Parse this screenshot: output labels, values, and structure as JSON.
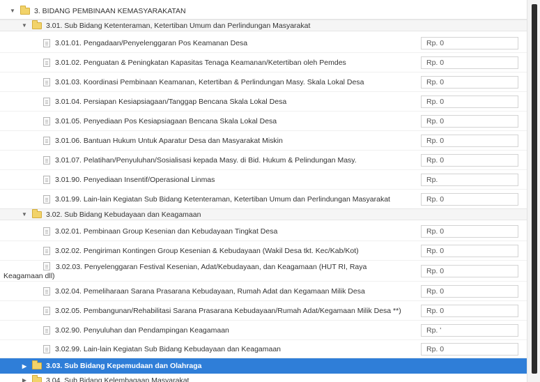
{
  "tree": {
    "bidang": "3. BIDANG PEMBINAAN KEMASYARAKATAN",
    "sub1": "3.01. Sub Bidang Ketenteraman, Ketertiban Umum dan Perlindungan Masyarakat",
    "items1": [
      {
        "label": "3.01.01. Pengadaan/Penyelenggaran Pos Keamanan Desa",
        "value": "Rp. 0"
      },
      {
        "label": "3.01.02. Penguatan & Peningkatan Kapasitas Tenaga Keamanan/Ketertiban oleh Pemdes",
        "value": "Rp. 0"
      },
      {
        "label": "3.01.03. Koordinasi Pembinaan Keamanan, Ketertiban & Perlindungan Masy. Skala Lokal Desa",
        "value": "Rp. 0"
      },
      {
        "label": "3.01.04. Persiapan Kesiapsiagaan/Tanggap Bencana Skala Lokal Desa",
        "value": "Rp. 0"
      },
      {
        "label": "3.01.05. Penyediaan Pos Kesiapsiagaan Bencana Skala Lokal Desa",
        "value": "Rp. 0"
      },
      {
        "label": "3.01.06. Bantuan Hukum Untuk Aparatur Desa dan Masyarakat Miskin",
        "value": "Rp. 0"
      },
      {
        "label": "3.01.07. Pelatihan/Penyuluhan/Sosialisasi kepada Masy. di Bid. Hukum & Pelindungan Masy.",
        "value": "Rp. 0"
      },
      {
        "label": "3.01.90. Penyediaan Insentif/Operasional Linmas",
        "value": "Rp."
      },
      {
        "label": "3.01.99. Lain-lain Kegiatan Sub Bidang Ketenteraman, Ketertiban Umum dan Perlindungan Masyarakat",
        "value": "Rp. 0"
      }
    ],
    "sub2": "3.02. Sub Bidang Kebudayaan dan Keagamaan",
    "items2": [
      {
        "label": "3.02.01. Pembinaan Group Kesenian dan Kebudayaan Tingkat Desa",
        "value": "Rp. 0"
      },
      {
        "label": "3.02.02. Pengiriman Kontingen Group Kesenian & Kebudayaan (Wakil Desa tkt. Kec/Kab/Kot)",
        "value": "Rp. 0"
      },
      {
        "label_line1": "3.02.03. Penyelenggaran Festival Kesenian, Adat/Kebudayaan, dan Keagamaan (HUT RI, Raya",
        "label_line2": "Keagamaan dll)",
        "value": "Rp. 0"
      },
      {
        "label": "3.02.04. Pemeliharaan Sarana Prasarana Kebudayaan, Rumah Adat dan Kegamaan Milik Desa",
        "value": "Rp. 0"
      },
      {
        "label": "3.02.05. Pembangunan/Rehabilitasi Sarana Prasarana Kebudayaan/Rumah Adat/Kegamaan Milik Desa **)",
        "value": "Rp. 0"
      },
      {
        "label": "3.02.90. Penyuluhan dan Pendampingan Keagamaan",
        "value": "Rp. '"
      },
      {
        "label": "3.02.99. Lain-lain Kegiatan Sub Bidang Kebudayaan dan Keagamaan",
        "value": "Rp. 0"
      }
    ],
    "sub3": "3.03. Sub Bidang Kepemudaan dan Olahraga",
    "sub4": "3.04. Sub Bidang Kelembagaan Masyarakat"
  },
  "colors": {
    "selected_row": "#2f7ed8",
    "folder": "#f2d36a"
  },
  "icons": {
    "expanded": "triangle-down",
    "collapsed": "triangle-right",
    "folder": "folder-icon",
    "leaf": "document-icon"
  }
}
